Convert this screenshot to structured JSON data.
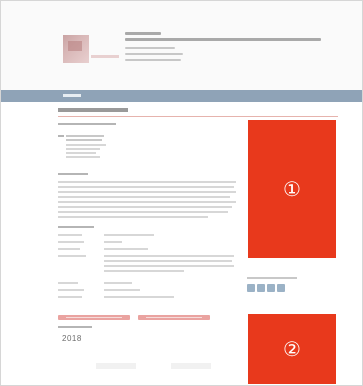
{
  "page": {
    "background": "#ffffff",
    "border_color": "#d6d6d6"
  },
  "header": {
    "logo_icon": "institution-logo-icon"
  },
  "navbar": {
    "color": "#8fa3b7"
  },
  "main": {
    "accent_color": "#e8391c"
  },
  "placeholders": [
    {
      "label": "①"
    },
    {
      "label": "②"
    }
  ],
  "social": {
    "icons": [
      "share-icon",
      "share-icon",
      "share-icon",
      "share-icon"
    ]
  },
  "footer_section": {
    "year": "2018"
  }
}
